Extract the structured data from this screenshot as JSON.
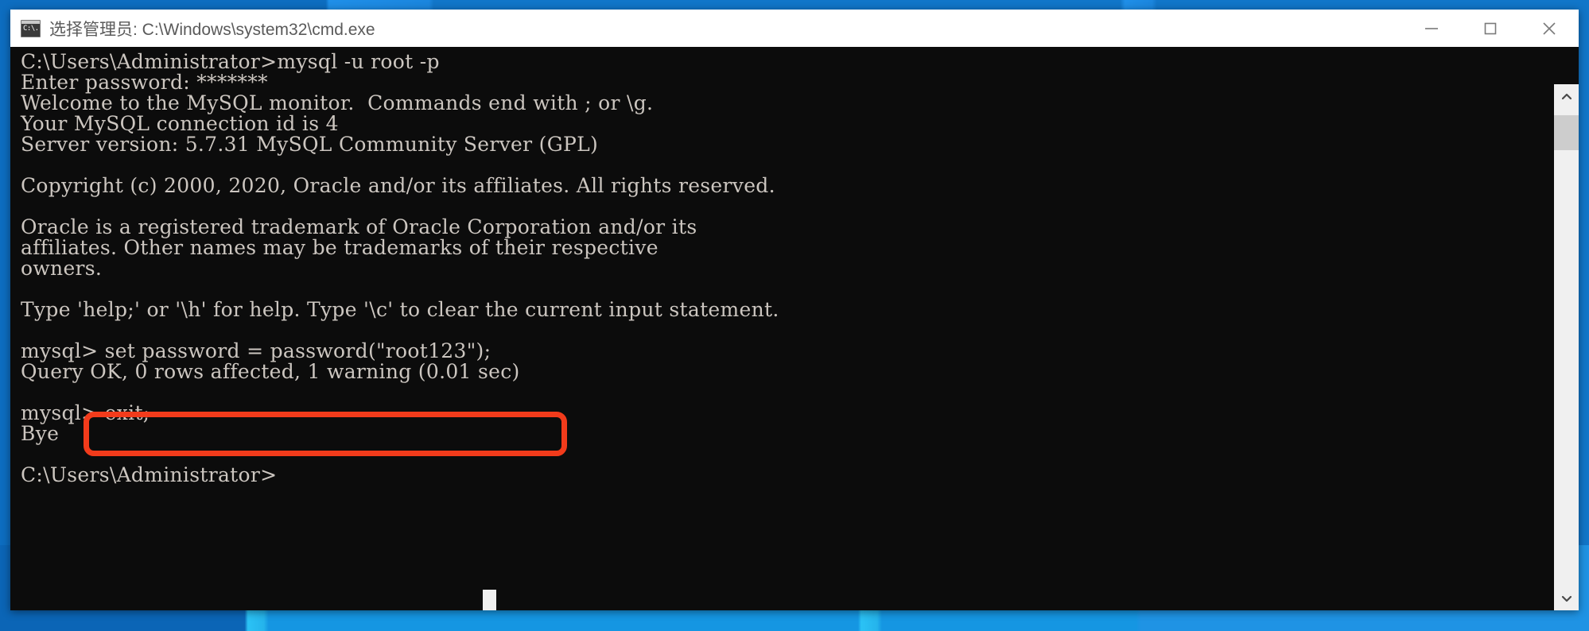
{
  "window": {
    "title": "选择管理员: C:\\Windows\\system32\\cmd.exe",
    "icon_glyph": "C:\\.",
    "icon_name": "cmd-icon",
    "minimize_label": "—",
    "maximize_label": "□",
    "close_label": "✕"
  },
  "colors": {
    "terminal_background": "#0c0c0c",
    "terminal_foreground": "#ccc6c0",
    "annotation_red": "#f23b1b",
    "titlebar_background": "#ffffff",
    "titlebar_text": "#5a5a5a",
    "desktop_blue": "#1176c9",
    "scrollbar_track": "#f0f0f0",
    "scrollbar_thumb": "#cdcdcd"
  },
  "terminal": {
    "lines": [
      "C:\\Users\\Administrator>mysql -u root -p",
      "Enter password: *******",
      "Welcome to the MySQL monitor.  Commands end with ; or \\g.",
      "Your MySQL connection id is 4",
      "Server version: 5.7.31 MySQL Community Server (GPL)",
      "",
      "Copyright (c) 2000, 2020, Oracle and/or its affiliates. All rights reserved.",
      "",
      "Oracle is a registered trademark of Oracle Corporation and/or its",
      "affiliates. Other names may be trademarks of their respective",
      "owners.",
      "",
      "Type 'help;' or '\\h' for help. Type '\\c' to clear the current input statement.",
      "",
      "mysql> set password = password(\"root123\");",
      "Query OK, 0 rows affected, 1 warning (0.01 sec)",
      "",
      "mysql> exit;",
      "Bye",
      "",
      "C:\\Users\\Administrator>"
    ],
    "prompt_windows": "C:\\Users\\Administrator>",
    "prompt_mysql": "mysql>",
    "cursor": "block",
    "highlighted_command": "set password = password(\"root123\");",
    "mysql_version": "5.7.31",
    "connection_id": "4",
    "query_result": "Query OK, 0 rows affected, 1 warning (0.01 sec)",
    "exit_message": "Bye"
  },
  "scrollbar": {
    "up_arrow": "chevron-up",
    "down_arrow": "chevron-down",
    "thumb_position_percent": 2
  }
}
